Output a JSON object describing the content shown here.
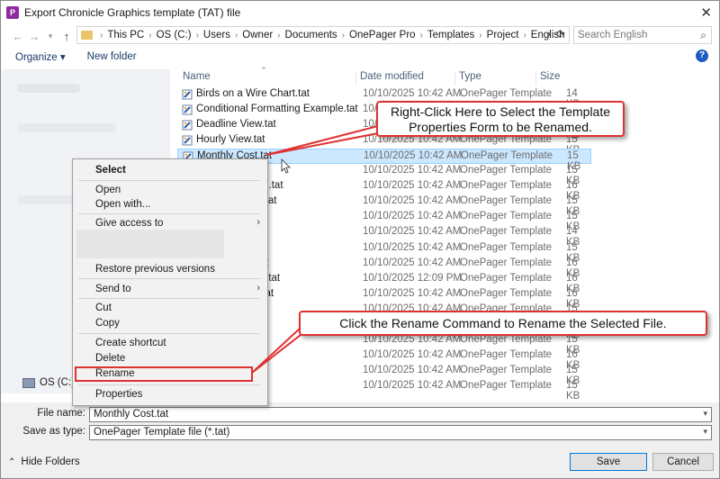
{
  "window": {
    "title": "Export Chronicle Graphics template (TAT) file",
    "app_icon_letter": "P"
  },
  "nav": {
    "breadcrumbs": [
      "This PC",
      "OS (C:)",
      "Users",
      "Owner",
      "Documents",
      "OnePager Pro",
      "Templates",
      "Project",
      "English"
    ],
    "search_placeholder": "Search English"
  },
  "toolbar": {
    "organize": "Organize ▾",
    "new_folder": "New folder"
  },
  "sidebar": {
    "os_drive": "OS (C:)"
  },
  "columns": {
    "name": "Name",
    "date": "Date modified",
    "type": "Type",
    "size": "Size"
  },
  "files": [
    {
      "name": "Birds on a Wire Chart.tat",
      "date": "10/10/2025 10:42 AM",
      "type": "OnePager Template",
      "size": "14 KB"
    },
    {
      "name": "Conditional Formatting Example.tat",
      "date": "10/10/2025 10:42 AM",
      "type": "OnePager Template",
      "size": "14 KB"
    },
    {
      "name": "Deadline View.tat",
      "date": "10/10/2025 10:42 AM",
      "type": "OnePager Template",
      "size": "14 KB"
    },
    {
      "name": "Hourly View.tat",
      "date": "10/10/2025 10:42 AM",
      "type": "OnePager Template",
      "size": "15 KB"
    },
    {
      "name": "Monthly Cost.tat",
      "date": "10/10/2025 10:42 AM",
      "type": "OnePager Template",
      "size": "15 KB"
    },
    {
      "name": "ked.tat",
      "date": "10/10/2025 10:42 AM",
      "type": "OnePager Template",
      "size": "15 KB"
    },
    {
      "name": "Chart - Detailed.tat",
      "date": "10/10/2025 10:42 AM",
      "type": "OnePager Template",
      "size": "16 KB"
    },
    {
      "name": "Chart - Simple.tat",
      "date": "10/10/2025 10:42 AM",
      "type": "OnePager Template",
      "size": "15 KB"
    },
    {
      "name": "one Chart.tat",
      "date": "10/10/2025 10:42 AM",
      "type": "OnePager Template",
      "size": "15 KB"
    },
    {
      "name": "ne.tat",
      "date": "10/10/2025 10:42 AM",
      "type": "OnePager Template",
      "size": "14 KB"
    },
    {
      "name": "cation View.tat",
      "date": "10/10/2025 10:42 AM",
      "type": "OnePager Template",
      "size": "15 KB"
    },
    {
      "name": "Harvey Balls.tat",
      "date": "10/10/2025 10:42 AM",
      "type": "OnePager Template",
      "size": "16 KB"
    },
    {
      "name": "View - Detailed.tat",
      "date": "10/10/2025 12:09 PM",
      "type": "OnePager Template",
      "size": "16 KB"
    },
    {
      "name": "View - Simple.tat",
      "date": "10/10/2025 10:42 AM",
      "type": "OnePager Template",
      "size": "16 KB"
    },
    {
      "name": "tone View.",
      "date": "10/10/2025 10:42 AM",
      "type": "OnePager Template",
      "size": "15 KB"
    },
    {
      "name": "ne View.ta",
      "date": "10/10/2025 10:42 AM",
      "type": "OnePager Template",
      "size": "15 KB"
    },
    {
      "name": "ine.tat",
      "date": "10/10/2025 10:42 AM",
      "type": "OnePager Template",
      "size": "15 KB"
    },
    {
      "name": "",
      "date": "10/10/2025 10:42 AM",
      "type": "OnePager Template",
      "size": "16 KB"
    },
    {
      "name": "tat",
      "date": "10/10/2025 10:42 AM",
      "type": "OnePager Template",
      "size": "15 KB"
    },
    {
      "name": "tiple Levels.tat",
      "date": "10/10/2025 10:42 AM",
      "type": "OnePager Template",
      "size": "15 KB"
    }
  ],
  "context_menu": {
    "select": "Select",
    "open": "Open",
    "open_with": "Open with...",
    "give_access": "Give access to",
    "restore": "Restore previous versions",
    "send_to": "Send to",
    "cut": "Cut",
    "copy": "Copy",
    "create_shortcut": "Create shortcut",
    "delete": "Delete",
    "rename": "Rename",
    "properties": "Properties"
  },
  "bottom": {
    "file_name_label": "File name:",
    "file_name_value": "Monthly Cost.tat",
    "save_type_label": "Save as type:",
    "save_type_value": "OnePager Template file  (*.tat)",
    "hide_folders": "Hide Folders",
    "save": "Save",
    "cancel": "Cancel"
  },
  "callouts": {
    "right_click": "Right-Click Here to Select the Template Properties Form to be Renamed.",
    "rename": "Click the Rename Command to Rename the Selected File."
  },
  "colors": {
    "accent": "#0078d7",
    "callout_border": "#e03131",
    "selection": "#cce8ff"
  }
}
